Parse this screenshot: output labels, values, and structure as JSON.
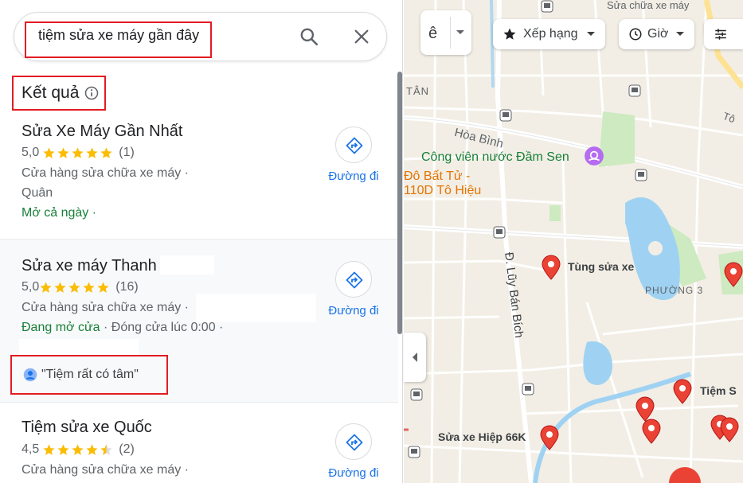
{
  "search": {
    "query": "tiệm sửa xe máy gần đây"
  },
  "results_header": "Kết quả",
  "results": [
    {
      "name": "Sửa Xe Máy Gần Nhất",
      "rating": "5,0",
      "stars": 5,
      "reviews": "(1)",
      "category": "Cửa hàng sửa chữa xe máy ·",
      "address": "Quân",
      "hours_status": "Mở cả ngày ·",
      "hours_detail": "",
      "directions_label": "Đường đi"
    },
    {
      "name": "Sửa xe máy Thanh",
      "rating": "5,0",
      "stars": 5,
      "reviews": "(16)",
      "category": "Cửa hàng sửa chữa xe máy ·",
      "address": "",
      "hours_status": "Đang mở cửa",
      "hours_detail": " · Đóng cửa lúc 0:00 ·",
      "review_snippet": "\"Tiệm rất có tâm\"",
      "directions_label": "Đường đi"
    },
    {
      "name": "Tiệm sửa xe Quốc",
      "rating": "4,5",
      "stars": 4.5,
      "reviews": "(2)",
      "category": "Cửa hàng sửa chữa xe máy ·",
      "directions_label": "Đường đi"
    }
  ],
  "filters": {
    "language_glyph": "ê",
    "rating_label": "Xếp hạng",
    "hours_label": "Giờ"
  },
  "map": {
    "labels": {
      "top_street": "Sửa chữa xe máy",
      "tan": "TÂN",
      "hoa_binh": "Hòa Bình",
      "park": "Công viên nước Đầm Sen",
      "temple_line1": "Đô Bất Tử -",
      "temple_line2": "110D Tô Hiệu",
      "street_luy_ban_bich": "Đ. Lũy Bán Bích",
      "ward": "PHƯỜNG 3",
      "shop_tung": "Tùng sửa xe",
      "shop_hiep": "Sửa xe Hiệp 66K",
      "shop_tiem": "Tiệm S",
      "corner_label": "Tô"
    }
  },
  "colors": {
    "accent_blue": "#1a73e8",
    "open_green": "#188038",
    "star_yellow": "#fbbc04",
    "annotation_red": "#e31b23",
    "pin_red": "#ea4335",
    "water_blue": "#9fd2f2"
  }
}
